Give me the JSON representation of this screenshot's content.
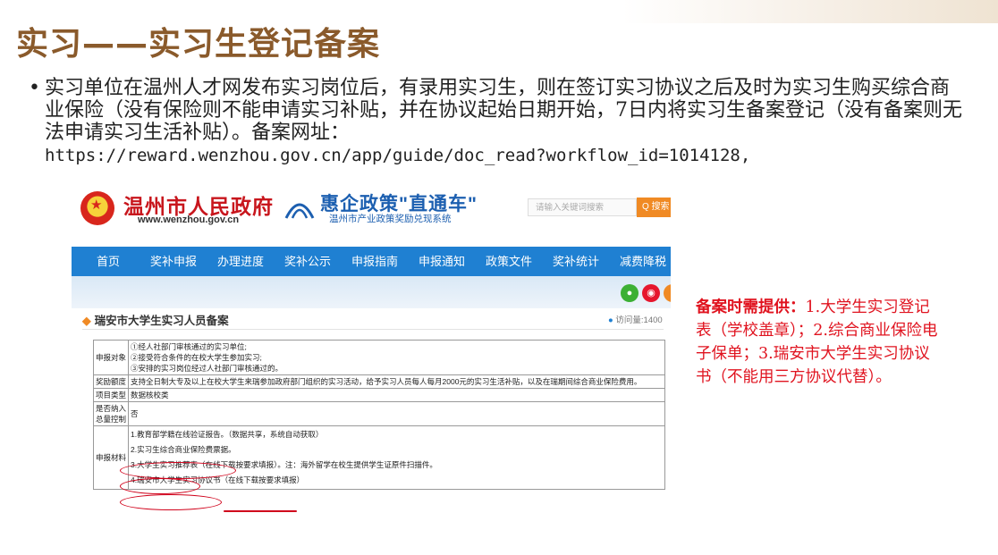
{
  "slide": {
    "title": "实习——实习生登记备案",
    "bullet_text": "实习单位在温州人才网发布实习岗位后，有录用实习生，则在签订实习协议之后及时为实习生购买综合商业保险（没有保险则不能申请实习补贴，并在协议起始日期开始，7日内将实习生备案登记（没有备案则无法申请实习生活补贴）。备案网址：",
    "bullet_url": "https://reward.wenzhou.gov.cn/app/guide/doc_read?workflow_id=1014128,",
    "note_label": "备案时需提供：",
    "note_body": "1.大学生实习登记表（学校盖章）；2.综合商业保险电子保单；3.瑞安市大学生实习协议书（不能用三方协议代替）。"
  },
  "site": {
    "gov_name": "温州市人民政府",
    "gov_url": "www.wenzhou.gov.cn",
    "portal_title": "惠企政策\"直通车\"",
    "portal_subtitle": "温州市产业政策奖励兑现系统",
    "search_placeholder": "请输入关键词搜索",
    "search_button": "Q 搜索",
    "nav": [
      "首页",
      "奖补申报",
      "办理进度",
      "奖补公示",
      "申报指南",
      "申报通知",
      "政策文件",
      "奖补统计",
      "减费降税"
    ],
    "section_title": "瑞安市大学生实习人员备案",
    "visits": "访问量:1400",
    "table": {
      "row1_key": "申报对象",
      "row1_lines": [
        "①经人社部门审核通过的实习单位;",
        "②接受符合条件的在校大学生参加实习;",
        "③安排的实习岗位经过人社部门审核通过的。"
      ],
      "row2_key": "奖励额度",
      "row2_value": "支持全日制大专及以上在校大学生来瑞参加政府部门组织的实习活动，给予实习人员每人每月2000元的实习生活补贴，以及在瑞期间综合商业保险费用。",
      "row3_key": "项目类型",
      "row3_value": "数据核校类",
      "row4_key": "是否纳入总量控制",
      "row4_value": "否",
      "row5_key": "申报材料",
      "row5_lines": [
        "1.教育部学籍在线验证报告。（数据共享，系统自动获取）",
        "2.实习生综合商业保险费票据。",
        "3.大学生实习推荐表（在线下载按要求填报）。注：海外留学在校生提供学生证原件扫描件。",
        "4.瑞安市大学生实习协议书（在线下载按要求填报）"
      ]
    }
  },
  "colors": {
    "title": "#8a5a2b",
    "nav": "#1f80d2",
    "note": "#e0131f",
    "gov_red": "#c8161d",
    "portal_blue": "#1c5fb0"
  }
}
